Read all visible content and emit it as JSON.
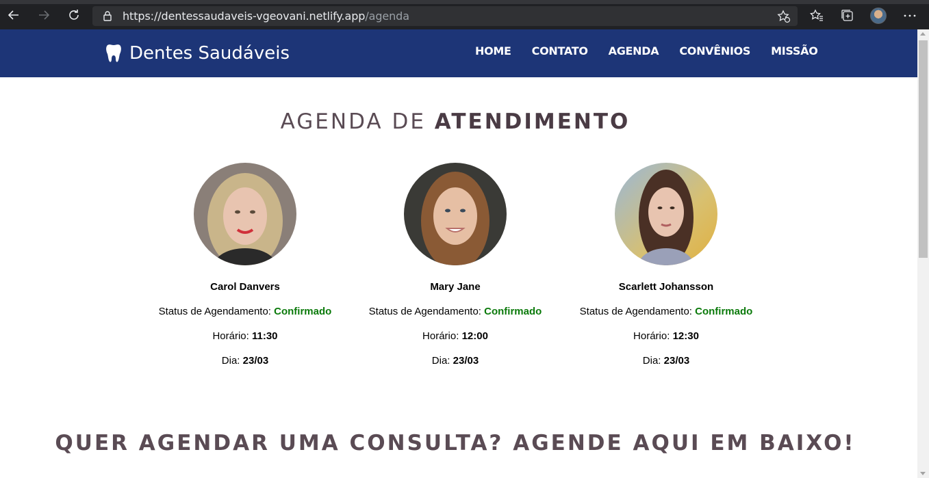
{
  "browser": {
    "url_host": "https://dentessaudaveis-vgeovani.netlify.app",
    "url_path": "/agenda"
  },
  "header": {
    "brand": "Dentes Saudáveis",
    "nav": [
      "HOME",
      "CONTATO",
      "AGENDA",
      "CONVÊNIOS",
      "MISSÃO"
    ]
  },
  "main": {
    "title_light": "AGENDA DE ",
    "title_bold": "ATENDIMENTO",
    "status_label": "Status de Agendamento: ",
    "time_label": "Horário: ",
    "day_label": "Dia: ",
    "patients": [
      {
        "name": "Carol Danvers",
        "status": "Confirmado",
        "time": "11:30",
        "day": "23/03"
      },
      {
        "name": "Mary Jane",
        "status": "Confirmado",
        "time": "12:00",
        "day": "23/03"
      },
      {
        "name": "Scarlett Johansson",
        "status": "Confirmado",
        "time": "12:30",
        "day": "23/03"
      }
    ],
    "cta": "QUER AGENDAR UMA CONSULTA? AGENDE AQUI EM BAIXO!"
  },
  "colors": {
    "header_bg": "#1d3577",
    "status_green": "#0b7a0b",
    "title_color": "#4a3b44"
  }
}
